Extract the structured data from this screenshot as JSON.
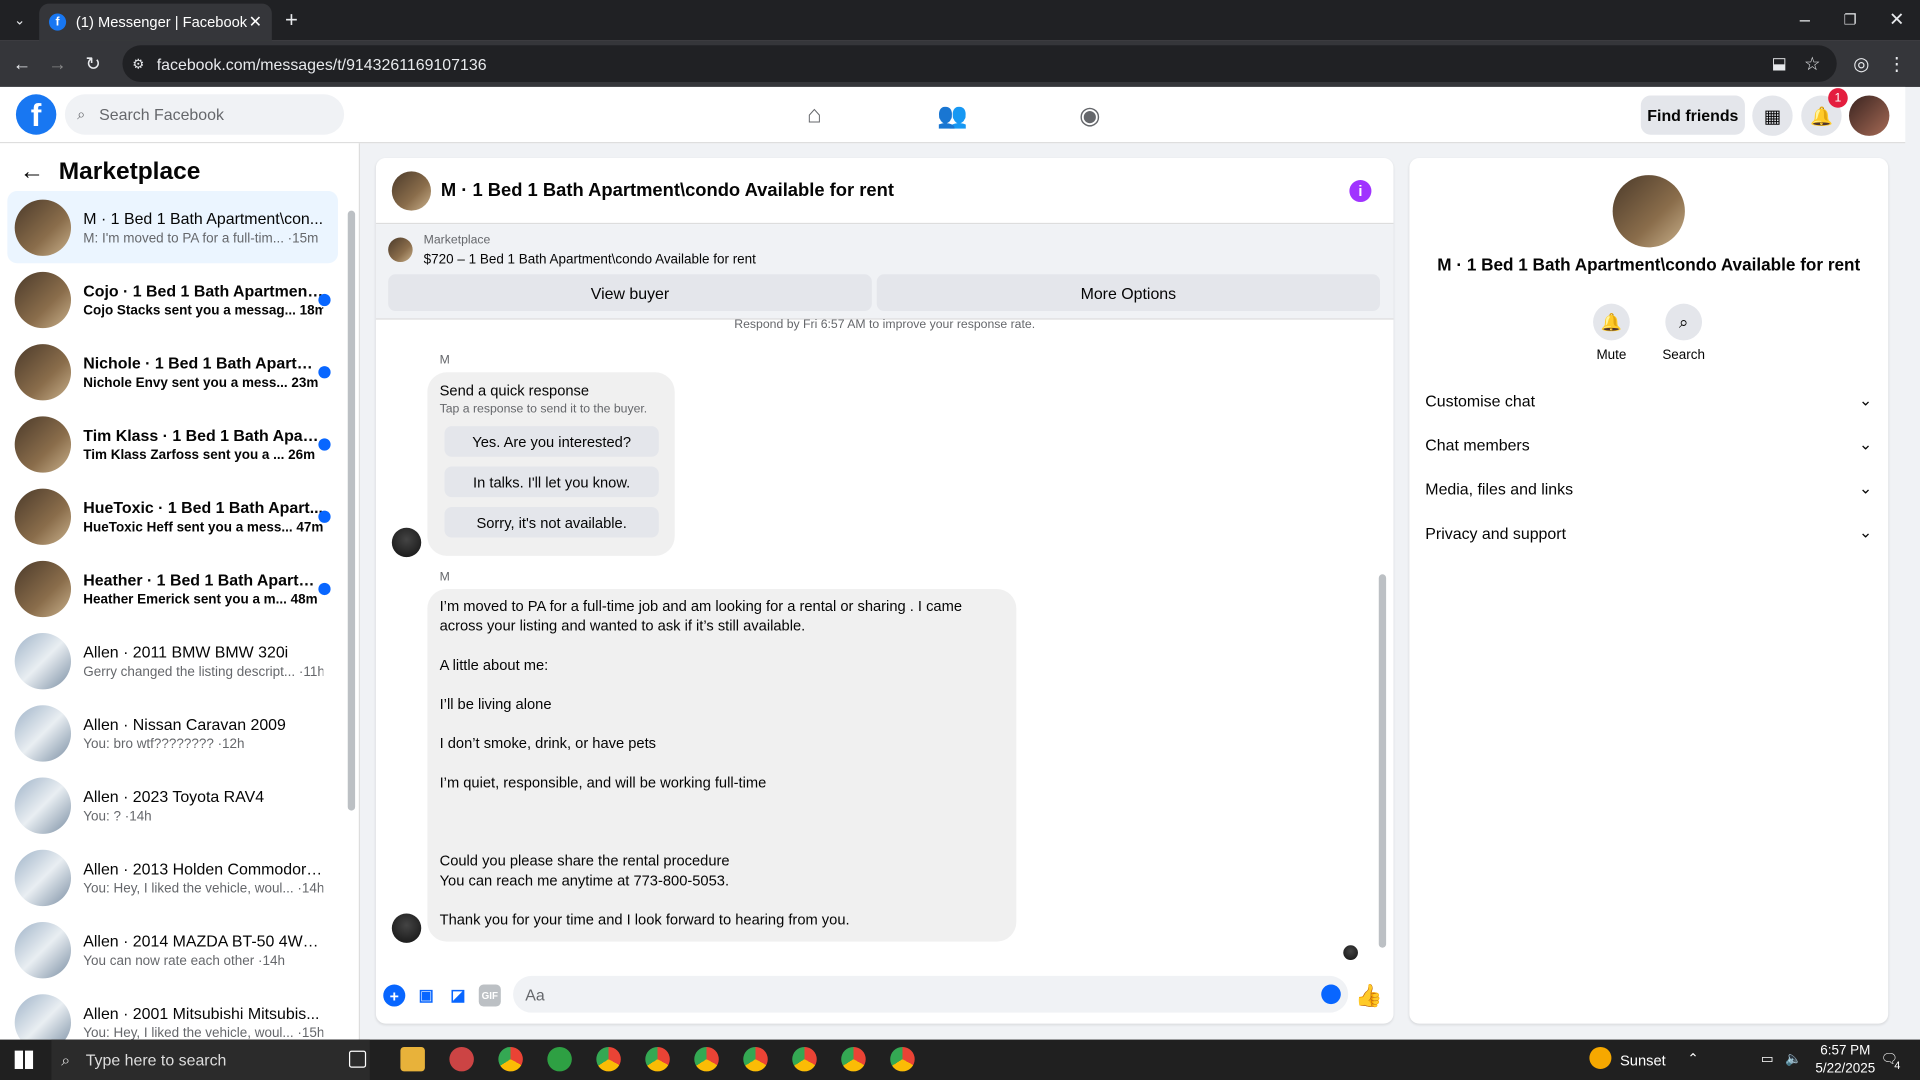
{
  "browser": {
    "tab_title": "(1) Messenger | Facebook",
    "url": "facebook.com/messages/t/9143261169107136"
  },
  "fbnav": {
    "search_placeholder": "Search Facebook",
    "find_friends": "Find friends",
    "notification_count": "1"
  },
  "sidebar": {
    "title": "Marketplace",
    "conversations": [
      {
        "title": "M · 1 Bed 1 Bath Apartment\\con...",
        "preview": "M: I'm moved to PA for a full-tim... ·15m",
        "unread": false,
        "active": true,
        "thumb": "apartment"
      },
      {
        "title": "Cojo · 1 Bed 1 Bath Apartment\\...",
        "preview": "Cojo Stacks sent you a messag... 18m",
        "unread": true,
        "active": false,
        "thumb": "apartment"
      },
      {
        "title": "Nichole · 1 Bed 1 Bath Apartm...",
        "preview": "Nichole Envy sent you a mess... 23m",
        "unread": true,
        "active": false,
        "thumb": "apartment"
      },
      {
        "title": "Tim Klass · 1 Bed 1 Bath Apart...",
        "preview": "Tim Klass Zarfoss sent you a ... 26m",
        "unread": true,
        "active": false,
        "thumb": "apartment"
      },
      {
        "title": "HueToxic · 1 Bed 1 Bath Apart...",
        "preview": "HueToxic Heff sent you a mess... 47m",
        "unread": true,
        "active": false,
        "thumb": "apartment"
      },
      {
        "title": "Heather · 1 Bed 1 Bath Apartm...",
        "preview": "Heather Emerick sent you a m... 48m",
        "unread": true,
        "active": false,
        "thumb": "apartment"
      },
      {
        "title": "Allen · 2011 BMW BMW 320i",
        "preview": "Gerry changed the listing descript... ·11h",
        "unread": false,
        "active": false,
        "thumb": "car"
      },
      {
        "title": "Allen · Nissan Caravan 2009",
        "preview": "You: bro wtf???????? ·12h",
        "unread": false,
        "active": false,
        "thumb": "car"
      },
      {
        "title": "Allen · 2023 Toyota RAV4",
        "preview": "You: ? ·14h",
        "unread": false,
        "active": false,
        "thumb": "car"
      },
      {
        "title": "Allen · 2013 Holden Commodore...",
        "preview": "You: Hey, I liked the vehicle, woul... ·14h",
        "unread": false,
        "active": false,
        "thumb": "car"
      },
      {
        "title": "Allen · 2014 MAZDA BT-50 4WD...",
        "preview": "You can now rate each other ·14h",
        "unread": false,
        "active": false,
        "thumb": "car"
      },
      {
        "title": "Allen · 2001 Mitsubishi Mitsubis...",
        "preview": "You: Hey, I liked the vehicle, woul... ·15h",
        "unread": false,
        "active": false,
        "thumb": "car"
      }
    ]
  },
  "chat": {
    "title": "M · 1 Bed 1 Bath Apartment\\condo Available for rent",
    "marketplace_label": "Marketplace",
    "listing": "$720 – 1 Bed 1 Bath Apartment\\condo Available for rent",
    "view_buyer": "View buyer",
    "more_options": "More Options",
    "respond_hint": "Respond by Fri 6:57 AM to improve your response rate.",
    "sender": "M",
    "quick_title": "Send a quick response",
    "quick_sub": "Tap a response to send it to the buyer.",
    "quick_options": [
      "Yes. Are you interested?",
      "In talks. I'll let you know.",
      "Sorry, it's not available."
    ],
    "message_lines": [
      "I’m moved to PA for a full-time job and am looking for a rental or sharing . I came",
      "across your listing and wanted to ask if it’s still available.",
      "",
      "A little about me:",
      "",
      "I’ll be living alone",
      "",
      "I don’t smoke, drink, or have pets",
      "",
      "I’m quiet, responsible, and will be working full-time",
      "",
      "",
      "",
      "Could you please share the rental procedure",
      "You can reach me anytime at 773-800-5053.",
      "",
      "Thank you for your time and I look forward to hearing from you."
    ],
    "composer_placeholder": "Aa"
  },
  "details": {
    "title": "M · 1 Bed 1 Bath Apartment\\condo Available for rent",
    "mute": "Mute",
    "search": "Search",
    "sections": [
      "Customise chat",
      "Chat members",
      "Media, files and links",
      "Privacy and support"
    ]
  },
  "taskbar": {
    "search_placeholder": "Type here to search",
    "weather": "Sunset",
    "time": "6:57 PM",
    "date": "5/22/2025",
    "notif_count": "4"
  },
  "colors": {
    "fb_blue": "#1877f2",
    "unread_dot": "#0866ff",
    "info_purple": "#a033ff"
  }
}
